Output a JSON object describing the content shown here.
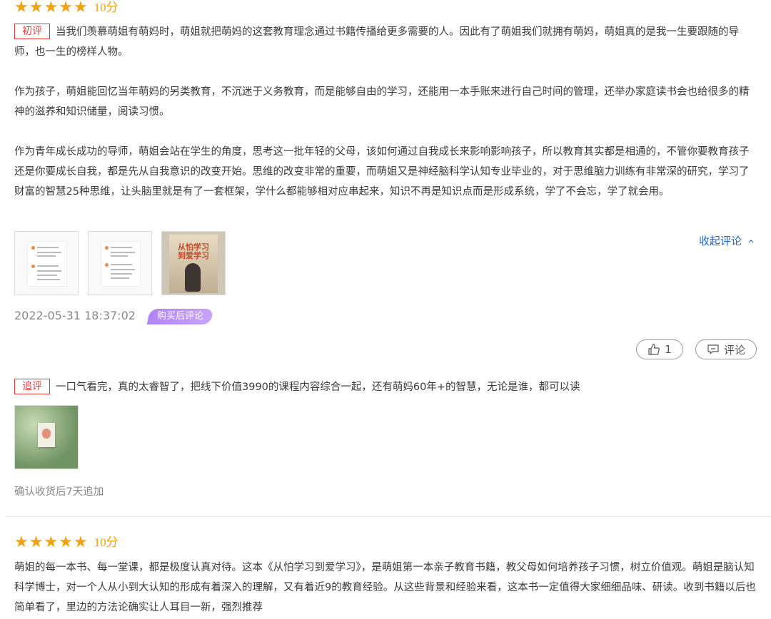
{
  "review1": {
    "rating": 5,
    "score_label": "10分",
    "tag": "初评",
    "paragraph1": "当我们羡慕萌姐有萌妈时，萌姐就把萌妈的这套教育理念通过书籍传播给更多需要的人。因此有了萌姐我们就拥有萌妈，萌姐真的是我一生要跟随的导师，也一生的榜样人物。",
    "paragraph2": "作为孩子，萌姐能回忆当年萌妈的另类教育，不沉迷于义务教育，而是能够自由的学习，还能用一本手账来进行自己时间的管理，还举办家庭读书会也给很多的精神的滋养和知识储量，阅读习惯。",
    "paragraph3": "作为青年成长成功的导师，萌姐会站在学生的角度，思考这一批年轻的父母，该如何通过自我成长来影响影响孩子，所以教育其实都是相通的，不管你要教育孩子还是你要成长自我，都是先从自我意识的改变开始。思维的改变非常的重要，而萌姐又是神经脑科学认知专业毕业的，对于思维脑力训练有非常深的研究，学习了财富的智慧25种思维，让头脑里就是有了一套框架，学什么都能够相对应串起来，知识不再是知识点而是形成系统，学了不会忘，学了就会用。",
    "collapse_label": "收起评论",
    "timestamp": "2022-05-31 18:37:02",
    "purchase_badge": "购买后评论",
    "like_count": "1",
    "comment_label": "评论",
    "cover_text": "从怕学习 到爱学习"
  },
  "followup": {
    "tag": "追评",
    "text": "一口气看完，真的太睿智了，把线下价值3990的课程内容综合一起，还有萌妈60年+的智慧，无论是谁，都可以读",
    "note": "确认收货后7天追加"
  },
  "review2": {
    "rating": 5,
    "score_label": "10分",
    "paragraph": "萌姐的每一本书、每一堂课，都是极度认真对待。这本《从怕学习到爱学习》，是萌姐第一本亲子教育书籍，教父母如何培养孩子习惯，树立价值观。萌姐是脑认知科学博士，对一个人从小到大认知的形成有着深入的理解，又有着近9的教育经验。从这些背景和经验来看，这本书一定值得大家细细品味、研读。收到书籍以后也简单看了，里边的方法论确实让人耳目一新，强烈推荐"
  },
  "colors": {
    "star": "#f2a20d",
    "tag_red": "#e4393c",
    "link_blue": "#2764c6",
    "badge_purple": "#b084f5"
  },
  "icons": [
    "star-icon",
    "chevron-up-icon",
    "thumbs-up-icon",
    "comment-icon"
  ]
}
